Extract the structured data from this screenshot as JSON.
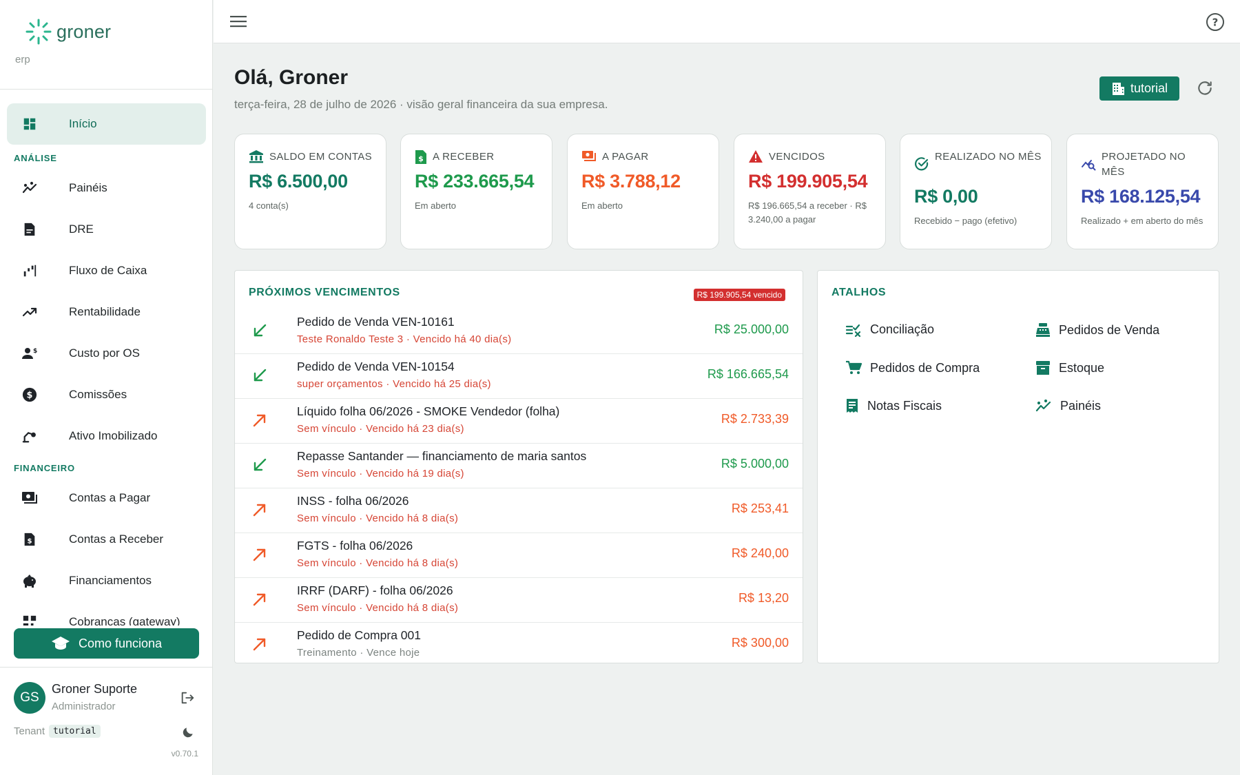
{
  "app": {
    "logo_text": "groner",
    "logo_sub": "erp"
  },
  "sidebar": {
    "items": [
      {
        "label": "Início",
        "icon": "dashboard-icon"
      },
      {
        "section": "ANÁLISE"
      },
      {
        "label": "Painéis",
        "icon": "insights-icon"
      },
      {
        "label": "DRE",
        "icon": "document-icon"
      },
      {
        "label": "Fluxo de Caixa",
        "icon": "cash-flow-icon"
      },
      {
        "label": "Rentabilidade",
        "icon": "trending-up-icon"
      },
      {
        "label": "Custo por OS",
        "icon": "people-cost-icon"
      },
      {
        "label": "Comissões",
        "icon": "dollar-circle-icon"
      },
      {
        "label": "Ativo Imobilizado",
        "icon": "asset-icon"
      },
      {
        "section": "FINANCEIRO"
      },
      {
        "label": "Contas a Pagar",
        "icon": "payments-icon"
      },
      {
        "label": "Contas a Receber",
        "icon": "receipt-icon"
      },
      {
        "label": "Financiamentos",
        "icon": "piggy-bank-icon"
      },
      {
        "label": "Cobranças (gateway)",
        "icon": "qr-icon"
      }
    ],
    "cta_label": "Como funciona",
    "user": {
      "initials": "GS",
      "name": "Groner Suporte",
      "role": "Administrador"
    },
    "tenant_label": "Tenant",
    "tenant_code": "tutorial",
    "version": "v0.70.1"
  },
  "header": {
    "greeting": "Olá, Groner",
    "subtitle": "terça-feira, 28 de julho de 2026 · visão geral financeira da sua empresa.",
    "tutorial_label": "tutorial"
  },
  "kpis": [
    {
      "title": "SALDO EM CONTAS",
      "value": "R$ 6.500,00",
      "note": "4 conta(s)",
      "color": "#137a62",
      "icon": "bank-icon"
    },
    {
      "title": "A RECEBER",
      "value": "R$ 233.665,54",
      "note": "Em aberto",
      "color": "#1e9a4c",
      "icon": "invoice-dollar-icon"
    },
    {
      "title": "A PAGAR",
      "value": "R$ 3.788,12",
      "note": "Em aberto",
      "color": "#f05a28",
      "icon": "payment-icon"
    },
    {
      "title": "VENCIDOS",
      "value": "R$ 199.905,54",
      "note": "R$ 196.665,54 a receber · R$ 3.240,00 a pagar",
      "color": "#d32f2f",
      "icon": "warning-icon"
    },
    {
      "title": "REALIZADO NO MÊS",
      "value": "R$ 0,00",
      "note": "Recebido − pago (efetivo)",
      "color": "#137a62",
      "icon": "check-circle-icon"
    },
    {
      "title": "PROJETADO NO MÊS",
      "value": "R$ 168.125,54",
      "note": "Realizado + em aberto do mês",
      "color": "#3949ab",
      "icon": "projection-icon"
    }
  ],
  "due": {
    "title": "PRÓXIMOS VENCIMENTOS",
    "badge": "R$ 199.905,54 vencido",
    "rows": [
      {
        "title": "Pedido de Venda VEN-10161",
        "sub": "Teste Ronaldo Teste 3 · Vencido há 40 dia(s)",
        "amount": "R$ 25.000,00",
        "dir": "in",
        "overdue": true
      },
      {
        "title": "Pedido de Venda VEN-10154",
        "sub": "super orçamentos · Vencido há 25 dia(s)",
        "amount": "R$ 166.665,54",
        "dir": "in",
        "overdue": true
      },
      {
        "title": "Líquido folha 06/2026 - SMOKE Vendedor (folha)",
        "sub": "Sem vínculo · Vencido há 23 dia(s)",
        "amount": "R$ 2.733,39",
        "dir": "out",
        "overdue": true
      },
      {
        "title": "Repasse Santander — financiamento de maria santos",
        "sub": "Sem vínculo · Vencido há 19 dia(s)",
        "amount": "R$ 5.000,00",
        "dir": "in",
        "overdue": true
      },
      {
        "title": "INSS - folha 06/2026",
        "sub": "Sem vínculo · Vencido há 8 dia(s)",
        "amount": "R$ 253,41",
        "dir": "out",
        "overdue": true
      },
      {
        "title": "FGTS - folha 06/2026",
        "sub": "Sem vínculo · Vencido há 8 dia(s)",
        "amount": "R$ 240,00",
        "dir": "out",
        "overdue": true
      },
      {
        "title": "IRRF (DARF) - folha 06/2026",
        "sub": "Sem vínculo · Vencido há 8 dia(s)",
        "amount": "R$ 13,20",
        "dir": "out",
        "overdue": true
      },
      {
        "title": "Pedido de Compra 001",
        "sub": "Treinamento · Vence hoje",
        "amount": "R$ 300,00",
        "dir": "out",
        "overdue": false
      }
    ]
  },
  "shortcuts": {
    "title": "ATALHOS",
    "items": [
      {
        "label": "Conciliação",
        "icon": "reconcile-icon"
      },
      {
        "label": "Pedidos de Venda",
        "icon": "cash-register-icon"
      },
      {
        "label": "Pedidos de Compra",
        "icon": "cart-icon"
      },
      {
        "label": "Estoque",
        "icon": "inventory-icon"
      },
      {
        "label": "Notas Fiscais",
        "icon": "invoice-icon"
      },
      {
        "label": "Painéis",
        "icon": "insights-icon"
      }
    ]
  },
  "colors": {
    "primary": "#137a62",
    "income": "#1e9a4c",
    "expense": "#f05a28",
    "danger": "#d32f2f",
    "projection": "#3949ab"
  }
}
